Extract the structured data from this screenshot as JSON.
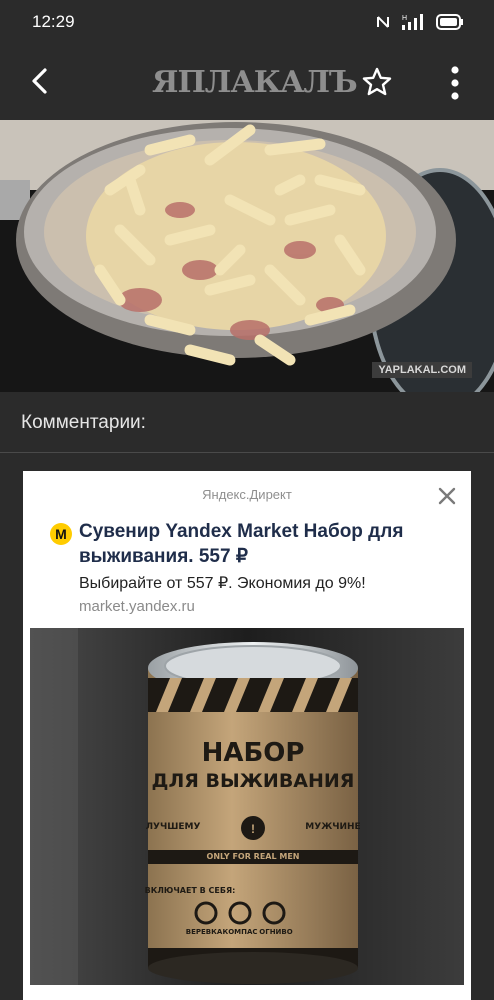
{
  "status": {
    "time": "12:29",
    "net_label": "H"
  },
  "appbar": {
    "logo_text": "ЯПЛАКАЛЪ"
  },
  "hero": {
    "watermark": "YAPLAKAL.COM"
  },
  "comments": {
    "title": "Комментарии:"
  },
  "ad": {
    "source": "Яндекс.Директ",
    "title": "Сувенир Yandex Market Набор для выживания. 557 ₽",
    "description": "Выбирайте от 557 ₽. Экономия до 9%!",
    "domain": "market.yandex.ru",
    "logo_letter": "М",
    "image_text": {
      "line1": "НАБОР",
      "line2": "ДЛЯ ВЫЖИВАНИЯ",
      "badge_left": "ЛУЧШЕМУ",
      "badge_right": "МУЖЧИНЕ",
      "strip": "ONLY FOR REAL MEN",
      "includes": "ВКЛЮЧАЕТ В СЕБЯ:",
      "items": [
        "ВЕРЕВКА",
        "КОМПАС",
        "ОГНИВО"
      ]
    }
  }
}
